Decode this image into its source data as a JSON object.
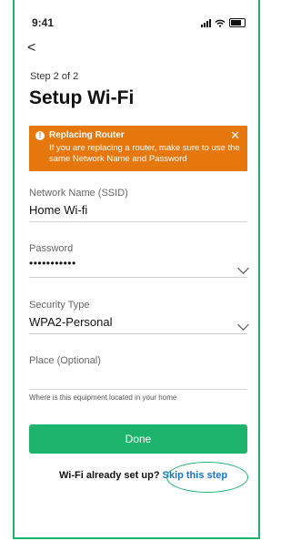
{
  "status_bar": {
    "time": "9:41"
  },
  "header": {
    "back_glyph": "<",
    "step": "Step 2 of 2",
    "title": "Setup Wi-Fi"
  },
  "banner": {
    "title": "Replacing Router",
    "text": "If you are replacing a router, make sure to use the same Network Name and Password",
    "close_glyph": "✕",
    "color": "#e5770c"
  },
  "form": {
    "network_label": "Network Name (SSID)",
    "network_value": "Home Wi-fi",
    "password_label": "Password",
    "password_value": "•••••••••••",
    "security_label": "Security Type",
    "security_value": "WPA2-Personal",
    "place_label": "Place (Optional)",
    "place_hint": "Where is this equipment located in your home"
  },
  "actions": {
    "done": "Done",
    "already_text": "Wi-Fi already set up?",
    "skip": "Skip this step",
    "accent": "#1eb36b",
    "link_color": "#1a73c8"
  }
}
